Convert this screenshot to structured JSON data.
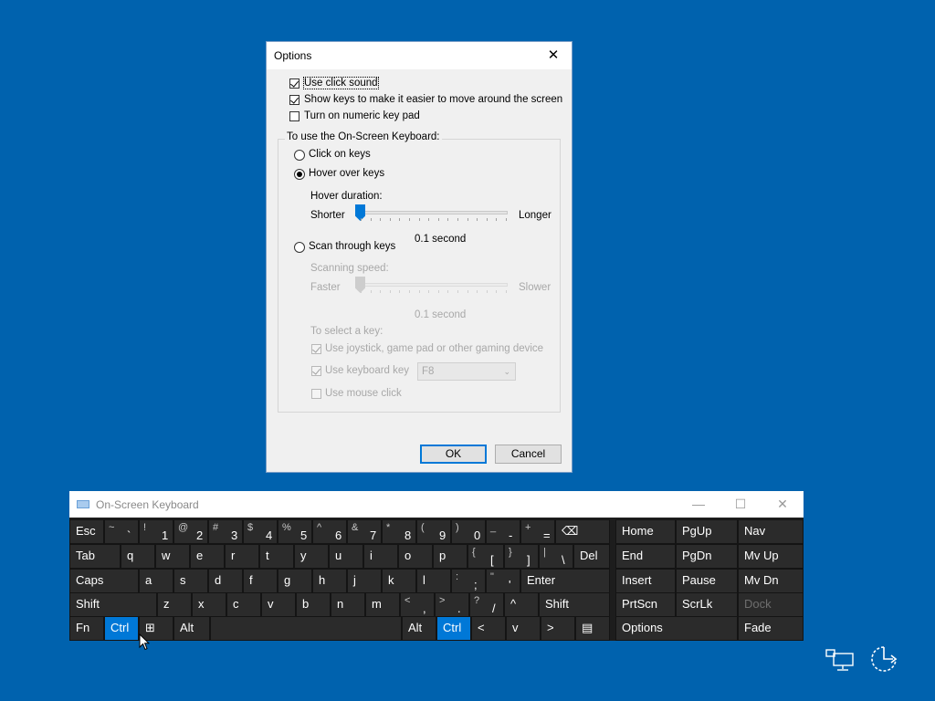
{
  "dialog": {
    "title": "Options",
    "close_glyph": "✕",
    "options": [
      {
        "label": "Use click sound",
        "checked": true
      },
      {
        "label": "Show keys to make it easier to move around the screen",
        "checked": true
      },
      {
        "label": "Turn on numeric key pad",
        "checked": false
      }
    ],
    "group_title": "To use the On-Screen Keyboard:",
    "mode_click": "Click on keys",
    "mode_hover": "Hover over keys",
    "hover_duration_label": "Hover duration:",
    "hover_min": "Shorter",
    "hover_max": "Longer",
    "hover_value": "0.1 second",
    "mode_scan": "Scan through keys",
    "scan_speed_label": "Scanning speed:",
    "scan_min": "Faster",
    "scan_max": "Slower",
    "scan_value": "0.1 second",
    "select_key_label": "To select a key:",
    "select_joystick": "Use joystick, game pad or other gaming device",
    "select_keyboard": "Use keyboard key",
    "select_keyboard_key": "F8",
    "select_mouse": "Use mouse click",
    "ok": "OK",
    "cancel": "Cancel"
  },
  "osk": {
    "title": "On-Screen Keyboard",
    "minimize": "—",
    "maximize": "☐",
    "close": "✕",
    "row1": [
      {
        "m": "Esc"
      },
      {
        "s": "~",
        "n": "`"
      },
      {
        "s": "!",
        "n": "1"
      },
      {
        "s": "@",
        "n": "2"
      },
      {
        "s": "#",
        "n": "3"
      },
      {
        "s": "$",
        "n": "4"
      },
      {
        "s": "%",
        "n": "5"
      },
      {
        "s": "^",
        "n": "6"
      },
      {
        "s": "&",
        "n": "7"
      },
      {
        "s": "*",
        "n": "8"
      },
      {
        "s": "(",
        "n": "9"
      },
      {
        "s": ")",
        "n": "0"
      },
      {
        "s": "_",
        "n": "-"
      },
      {
        "s": "+",
        "n": "="
      },
      {
        "m": "⌫"
      },
      {
        "m": "Home"
      },
      {
        "m": "PgUp"
      },
      {
        "m": "Nav"
      }
    ],
    "row2": [
      {
        "m": "Tab"
      },
      {
        "m": "q"
      },
      {
        "m": "w"
      },
      {
        "m": "e"
      },
      {
        "m": "r"
      },
      {
        "m": "t"
      },
      {
        "m": "y"
      },
      {
        "m": "u"
      },
      {
        "m": "i"
      },
      {
        "m": "o"
      },
      {
        "m": "p"
      },
      {
        "s": "{",
        "n": "["
      },
      {
        "s": "}",
        "n": "]"
      },
      {
        "s": "|",
        "n": "\\"
      },
      {
        "m": "Del"
      },
      {
        "m": "End"
      },
      {
        "m": "PgDn"
      },
      {
        "m": "Mv Up"
      }
    ],
    "row3": [
      {
        "m": "Caps"
      },
      {
        "m": "a"
      },
      {
        "m": "s"
      },
      {
        "m": "d"
      },
      {
        "m": "f"
      },
      {
        "m": "g"
      },
      {
        "m": "h"
      },
      {
        "m": "j"
      },
      {
        "m": "k"
      },
      {
        "m": "l"
      },
      {
        "s": ":",
        "n": ";"
      },
      {
        "s": "\"",
        "n": "'"
      },
      {
        "m": "Enter"
      },
      {
        "m": "Insert"
      },
      {
        "m": "Pause"
      },
      {
        "m": "Mv Dn"
      }
    ],
    "row4": [
      {
        "m": "Shift"
      },
      {
        "m": "z"
      },
      {
        "m": "x"
      },
      {
        "m": "c"
      },
      {
        "m": "v"
      },
      {
        "m": "b"
      },
      {
        "m": "n"
      },
      {
        "m": "m"
      },
      {
        "s": "<",
        "n": ","
      },
      {
        "s": ">",
        "n": "."
      },
      {
        "s": "?",
        "n": "/"
      },
      {
        "m": "^"
      },
      {
        "m": "Shift"
      },
      {
        "m": "PrtScn"
      },
      {
        "m": "ScrLk"
      },
      {
        "m": "Dock"
      }
    ],
    "row5": [
      {
        "m": "Fn"
      },
      {
        "m": "Ctrl"
      },
      {
        "m": "⊞"
      },
      {
        "m": "Alt"
      },
      {
        "m": ""
      },
      {
        "m": "Alt"
      },
      {
        "m": "Ctrl"
      },
      {
        "m": "<"
      },
      {
        "m": "v"
      },
      {
        "m": ">"
      },
      {
        "m": "▤"
      },
      {
        "m": "Options"
      },
      {
        "m": "Fade"
      }
    ]
  },
  "colors": {
    "desktop": "#0062ae",
    "accent": "#0078d7",
    "key": "#2b2b2b"
  },
  "tray": {
    "icons": [
      "network-icon",
      "ease-of-access-icon"
    ]
  }
}
